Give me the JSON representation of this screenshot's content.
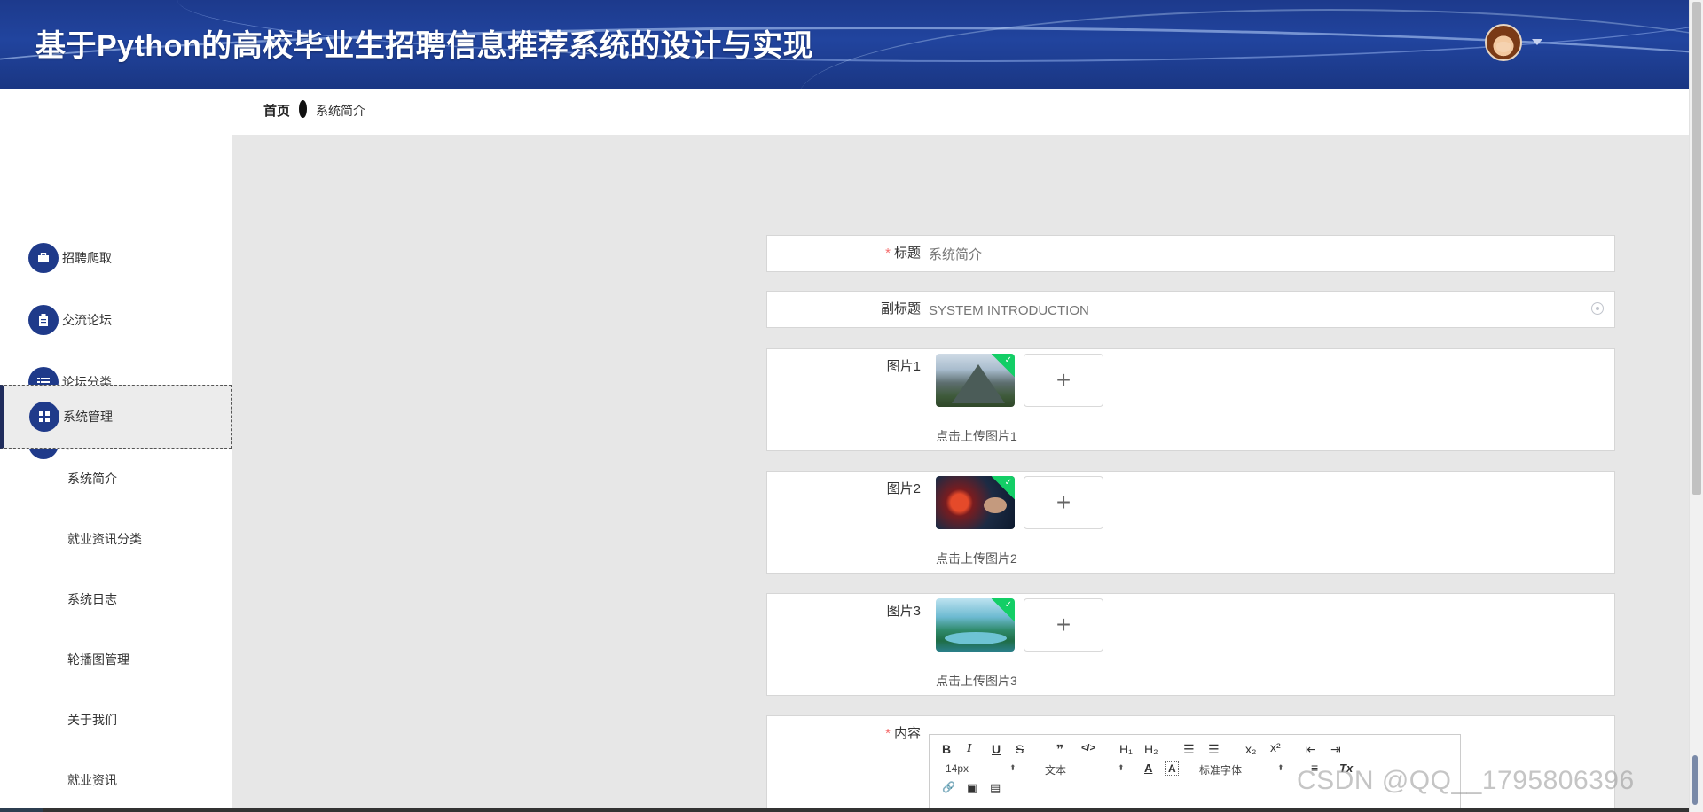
{
  "header": {
    "title": "基于Python的高校毕业生招聘信息推荐系统的设计与实现",
    "avatar_icon": "user-avatar",
    "caret_icon": "caret-down-icon"
  },
  "breadcrumb": {
    "home": "首页",
    "current": "系统简介"
  },
  "sidebar": {
    "items": [
      {
        "label": "招聘爬取",
        "icon": "briefcase-icon",
        "glyph": "▪"
      },
      {
        "label": "交流论坛",
        "icon": "clipboard-icon",
        "glyph": "▮"
      },
      {
        "label": "论坛分类",
        "icon": "list-icon",
        "glyph": "≡"
      },
      {
        "label": "举报记录",
        "icon": "grid-icon",
        "glyph": "▦"
      },
      {
        "label": "系统管理",
        "icon": "grid-icon",
        "glyph": "▦",
        "active": true
      }
    ],
    "sub_items": [
      {
        "label": "系统简介"
      },
      {
        "label": "就业资讯分类"
      },
      {
        "label": "系统日志"
      },
      {
        "label": "轮播图管理"
      },
      {
        "label": "关于我们"
      },
      {
        "label": "就业资讯"
      }
    ]
  },
  "form": {
    "title_label": "标题",
    "title_placeholder": "系统简介",
    "subtitle_label": "副标题",
    "subtitle_placeholder": "SYSTEM INTRODUCTION",
    "images": [
      {
        "label": "图片1",
        "tip": "点击上传图片1"
      },
      {
        "label": "图片2",
        "tip": "点击上传图片2"
      },
      {
        "label": "图片3",
        "tip": "点击上传图片3"
      }
    ],
    "upload_plus": "+",
    "content_label": "内容",
    "required_mark": "*"
  },
  "editor": {
    "bold": "B",
    "italic": "I",
    "underline": "U",
    "strike": "S",
    "quote": "❞",
    "code": "</>",
    "h1": "H₁",
    "h2": "H₂",
    "ordered_list": "☰",
    "bullet_list": "☰",
    "subscript": "x₂",
    "superscript": "x²",
    "outdent": "⇤",
    "indent": "⇥",
    "font_size": "14px",
    "header_type": "文本",
    "font_color": "A",
    "bg_color": "A",
    "font_family": "标准字体",
    "align": "≡",
    "clean": "Tx",
    "link": "🔗",
    "image": "▣",
    "video": "▤"
  },
  "watermark": "CSDN @QQ__1795806396",
  "colors": {
    "header_bg": "#1d3a8c",
    "menu_icon_bg": "#1f3a8a",
    "content_bg": "#e7e7e7",
    "required": "#f56c6c",
    "upload_success": "#13ce66"
  }
}
